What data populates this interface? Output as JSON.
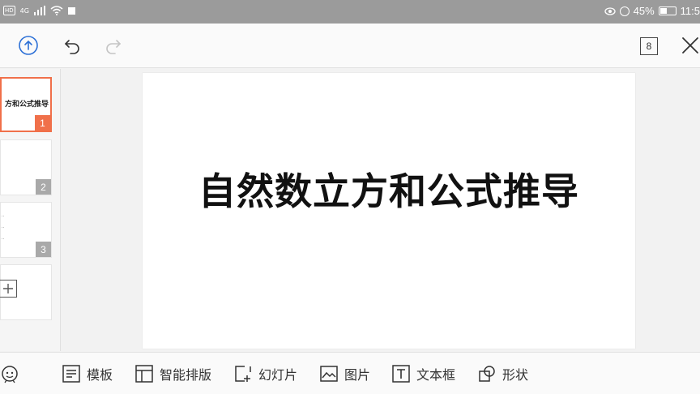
{
  "status_bar": {
    "badge_hd": "HD",
    "network": "4G",
    "battery_pct": "45%",
    "battery_level": 0.45,
    "time": "11:5"
  },
  "toolbar": {
    "page_count": "8"
  },
  "thumbnails": [
    {
      "title": "方和公式推导",
      "number": "1",
      "active": true
    },
    {
      "title": "",
      "number": "2",
      "active": false
    },
    {
      "title": "",
      "number": "3",
      "active": false
    }
  ],
  "slide": {
    "title": "自然数立方和公式推导"
  },
  "bottom_bar": {
    "template": "模板",
    "smart_layout": "智能排版",
    "slide": "幻灯片",
    "picture": "图片",
    "textbox": "文本框",
    "shape": "形状"
  },
  "colors": {
    "accent": "#f0704a",
    "status_bar": "#9b9b9b",
    "upload_icon": "#2b6fd6"
  }
}
